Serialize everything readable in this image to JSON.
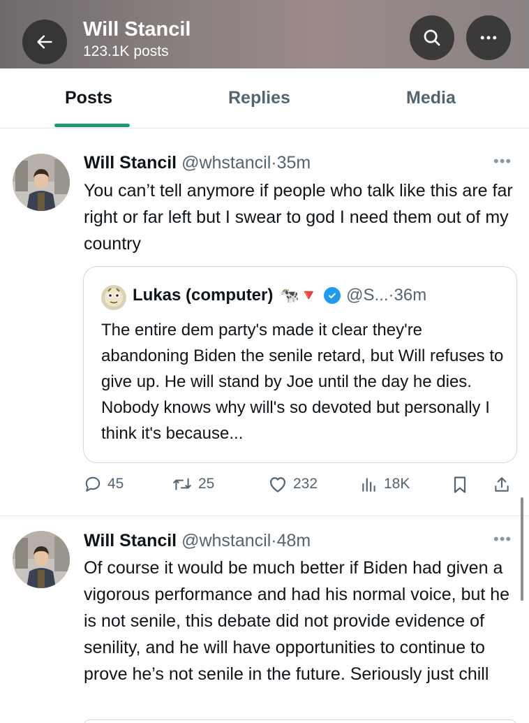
{
  "header": {
    "title": "Will Stancil",
    "subtitle": "123.1K posts",
    "icons": {
      "back": "arrow-left-icon",
      "search": "search-icon",
      "more": "more-horizontal-icon"
    }
  },
  "tabs": [
    {
      "label": "Posts",
      "active": true
    },
    {
      "label": "Replies",
      "active": false
    },
    {
      "label": "Media",
      "active": false
    }
  ],
  "posts": [
    {
      "author": "Will Stancil",
      "handle": "@whstancil",
      "dot": "·",
      "time": "35m",
      "text": "You can’t tell anymore if people who talk like this are far right or far left but I swear to god I need them out of my country",
      "quote": {
        "author": "Lukas (computer)",
        "emoji": "🐄🔻",
        "handle": "@S...",
        "dot": "·",
        "time": "36m",
        "text": "The entire dem party's made it clear they're abandoning Biden the senile retard, but Will refuses to give up. He will stand by Joe until the day he dies. Nobody knows why will's so devoted but personally I think it's because..."
      },
      "stats": {
        "replies": "45",
        "reposts": "25",
        "likes": "232",
        "views": "18K"
      }
    },
    {
      "author": "Will Stancil",
      "handle": "@whstancil",
      "dot": "·",
      "time": "48m",
      "text": "Of course it would be much better if Biden had given a vigorous performance and had his normal voice, but he is not senile, this debate did not provide evidence of senility, and he will have opportunities to continue to prove he’s not senile in the future. Seriously just chill"
    }
  ],
  "colors": {
    "accent": "#1c9b72",
    "muted": "#536471",
    "verified": "#1d9bf0"
  }
}
